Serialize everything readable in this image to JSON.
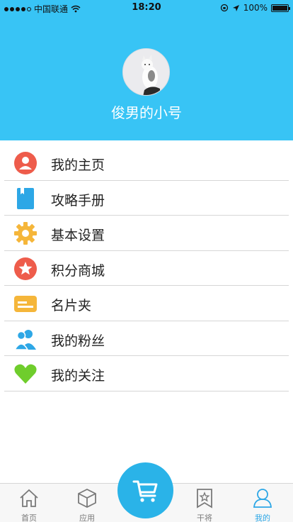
{
  "status": {
    "carrier": "中国联通",
    "time": "18:20",
    "battery": "100%"
  },
  "profile": {
    "name": "俊男的小号"
  },
  "menu": [
    {
      "label": "我的主页",
      "icon": "user-circle-icon",
      "color": "#ee5c4b"
    },
    {
      "label": "攻略手册",
      "icon": "book-icon",
      "color": "#2da7e6"
    },
    {
      "label": "基本设置",
      "icon": "gear-icon",
      "color": "#f5b63a"
    },
    {
      "label": "积分商城",
      "icon": "star-circle-icon",
      "color": "#ee5c4b"
    },
    {
      "label": "名片夹",
      "icon": "card-icon",
      "color": "#f5b63a"
    },
    {
      "label": "我的粉丝",
      "icon": "users-icon",
      "color": "#2da7e6"
    },
    {
      "label": "我的关注",
      "icon": "heart-icon",
      "color": "#6fcd2c"
    }
  ],
  "tabs": [
    {
      "label": "首页",
      "icon": "home-icon"
    },
    {
      "label": "应用",
      "icon": "cube-icon"
    },
    {
      "label": "干将",
      "icon": "bookmark-star-icon"
    },
    {
      "label": "我的",
      "icon": "person-icon",
      "active": true
    }
  ],
  "colors": {
    "header": "#38c4f5",
    "accent": "#2da7e6"
  }
}
